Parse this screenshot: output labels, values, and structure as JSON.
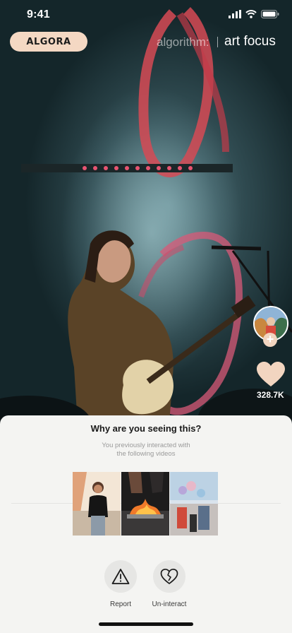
{
  "status_bar": {
    "time": "9:41"
  },
  "header": {
    "brand": "ALGORA",
    "algorithm_label": "algorithm:",
    "algorithm_value": "art focus"
  },
  "video": {
    "like_count": "328.7K",
    "follow_symbol": "+"
  },
  "sheet": {
    "title": "Why are you seeing this?",
    "subtitle_line1": "You previously interacted with",
    "subtitle_line2": "the following videos",
    "actions": [
      {
        "label": "Report",
        "icon": "warning-icon"
      },
      {
        "label": "Un-interact",
        "icon": "broken-heart-icon"
      }
    ]
  },
  "colors": {
    "brand_pill": "#f4d8c3",
    "sheet_bg": "#f4f4f2",
    "like_heart": "#f2d5c0"
  }
}
